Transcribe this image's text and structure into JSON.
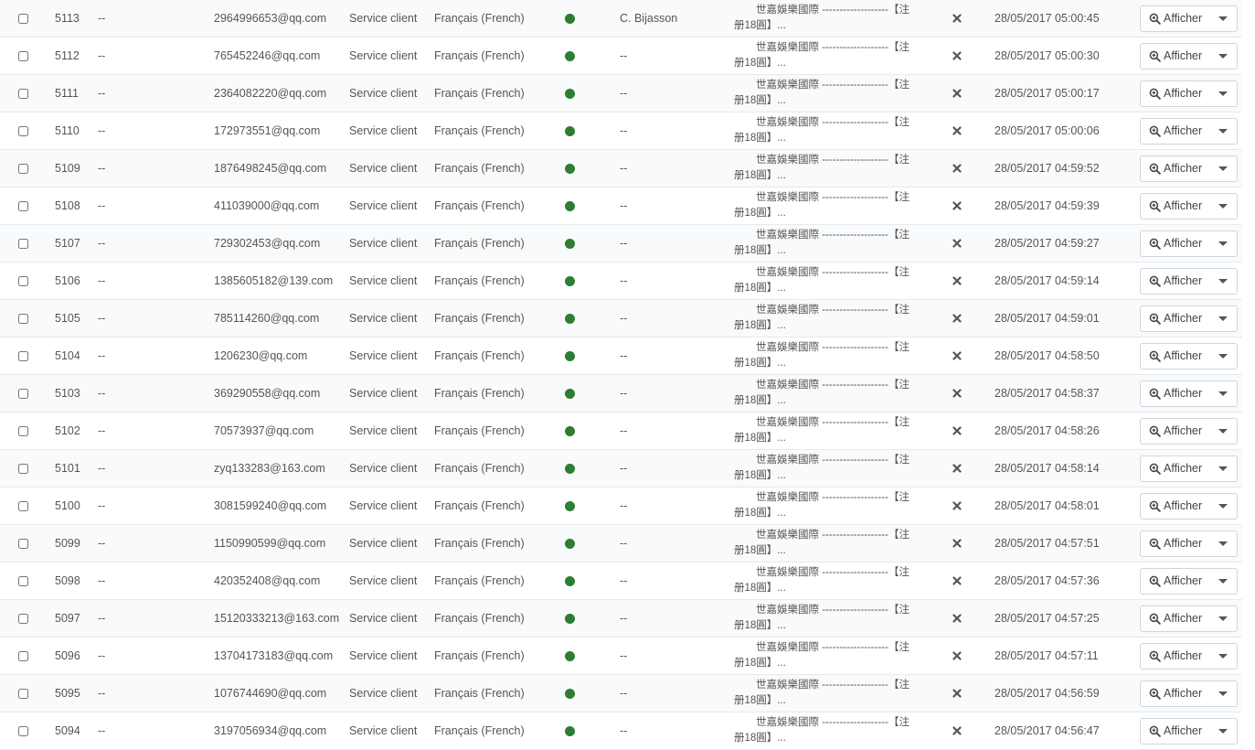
{
  "rows": [
    {
      "id": "5113",
      "col2": "--",
      "email": "2964996653@qq.com",
      "contact": "Service client",
      "language": "Français (French)",
      "employee": "C. Bijasson",
      "message_line1": "世嘉娛樂國際 -------------------【注",
      "message_line2": "册18圓】...",
      "date": "28/05/2017 05:00:45",
      "action_label": "Afficher"
    },
    {
      "id": "5112",
      "col2": "--",
      "email": "765452246@qq.com",
      "contact": "Service client",
      "language": "Français (French)",
      "employee": "--",
      "message_line1": "世嘉娛樂國際 -------------------【注",
      "message_line2": "册18圓】...",
      "date": "28/05/2017 05:00:30",
      "action_label": "Afficher"
    },
    {
      "id": "5111",
      "col2": "--",
      "email": "2364082220@qq.com",
      "contact": "Service client",
      "language": "Français (French)",
      "employee": "--",
      "message_line1": "世嘉娛樂國際 -------------------【注",
      "message_line2": "册18圓】...",
      "date": "28/05/2017 05:00:17",
      "action_label": "Afficher"
    },
    {
      "id": "5110",
      "col2": "--",
      "email": "172973551@qq.com",
      "contact": "Service client",
      "language": "Français (French)",
      "employee": "--",
      "message_line1": "世嘉娛樂國際 -------------------【注",
      "message_line2": "册18圓】...",
      "date": "28/05/2017 05:00:06",
      "action_label": "Afficher"
    },
    {
      "id": "5109",
      "col2": "--",
      "email": "1876498245@qq.com",
      "contact": "Service client",
      "language": "Français (French)",
      "employee": "--",
      "message_line1": "世嘉娛樂國際 -------------------【注",
      "message_line2": "册18圓】...",
      "date": "28/05/2017 04:59:52",
      "action_label": "Afficher"
    },
    {
      "id": "5108",
      "col2": "--",
      "email": "411039000@qq.com",
      "contact": "Service client",
      "language": "Français (French)",
      "employee": "--",
      "message_line1": "世嘉娛樂國際 -------------------【注",
      "message_line2": "册18圓】...",
      "date": "28/05/2017 04:59:39",
      "action_label": "Afficher"
    },
    {
      "id": "5107",
      "col2": "--",
      "email": "729302453@qq.com",
      "contact": "Service client",
      "language": "Français (French)",
      "employee": "--",
      "message_line1": "世嘉娛樂國際 -------------------【注",
      "message_line2": "册18圓】...",
      "date": "28/05/2017 04:59:27",
      "action_label": "Afficher"
    },
    {
      "id": "5106",
      "col2": "--",
      "email": "1385605182@139.com",
      "contact": "Service client",
      "language": "Français (French)",
      "employee": "--",
      "message_line1": "世嘉娛樂國際 -------------------【注",
      "message_line2": "册18圓】...",
      "date": "28/05/2017 04:59:14",
      "action_label": "Afficher"
    },
    {
      "id": "5105",
      "col2": "--",
      "email": "785114260@qq.com",
      "contact": "Service client",
      "language": "Français (French)",
      "employee": "--",
      "message_line1": "世嘉娛樂國際 -------------------【注",
      "message_line2": "册18圓】...",
      "date": "28/05/2017 04:59:01",
      "action_label": "Afficher"
    },
    {
      "id": "5104",
      "col2": "--",
      "email": "1206230@qq.com",
      "contact": "Service client",
      "language": "Français (French)",
      "employee": "--",
      "message_line1": "世嘉娛樂國際 -------------------【注",
      "message_line2": "册18圓】...",
      "date": "28/05/2017 04:58:50",
      "action_label": "Afficher"
    },
    {
      "id": "5103",
      "col2": "--",
      "email": "369290558@qq.com",
      "contact": "Service client",
      "language": "Français (French)",
      "employee": "--",
      "message_line1": "世嘉娛樂國際 -------------------【注",
      "message_line2": "册18圓】...",
      "date": "28/05/2017 04:58:37",
      "action_label": "Afficher"
    },
    {
      "id": "5102",
      "col2": "--",
      "email": "70573937@qq.com",
      "contact": "Service client",
      "language": "Français (French)",
      "employee": "--",
      "message_line1": "世嘉娛樂國際 -------------------【注",
      "message_line2": "册18圓】...",
      "date": "28/05/2017 04:58:26",
      "action_label": "Afficher"
    },
    {
      "id": "5101",
      "col2": "--",
      "email": "zyq133283@163.com",
      "contact": "Service client",
      "language": "Français (French)",
      "employee": "--",
      "message_line1": "世嘉娛樂國際 -------------------【注",
      "message_line2": "册18圓】...",
      "date": "28/05/2017 04:58:14",
      "action_label": "Afficher"
    },
    {
      "id": "5100",
      "col2": "--",
      "email": "3081599240@qq.com",
      "contact": "Service client",
      "language": "Français (French)",
      "employee": "--",
      "message_line1": "世嘉娛樂國際 -------------------【注",
      "message_line2": "册18圓】...",
      "date": "28/05/2017 04:58:01",
      "action_label": "Afficher"
    },
    {
      "id": "5099",
      "col2": "--",
      "email": "1150990599@qq.com",
      "contact": "Service client",
      "language": "Français (French)",
      "employee": "--",
      "message_line1": "世嘉娛樂國際 -------------------【注",
      "message_line2": "册18圓】...",
      "date": "28/05/2017 04:57:51",
      "action_label": "Afficher"
    },
    {
      "id": "5098",
      "col2": "--",
      "email": "420352408@qq.com",
      "contact": "Service client",
      "language": "Français (French)",
      "employee": "--",
      "message_line1": "世嘉娛樂國際 -------------------【注",
      "message_line2": "册18圓】...",
      "date": "28/05/2017 04:57:36",
      "action_label": "Afficher"
    },
    {
      "id": "5097",
      "col2": "--",
      "email": "15120333213@163.com",
      "contact": "Service client",
      "language": "Français (French)",
      "employee": "--",
      "message_line1": "世嘉娛樂國際 -------------------【注",
      "message_line2": "册18圓】...",
      "date": "28/05/2017 04:57:25",
      "action_label": "Afficher"
    },
    {
      "id": "5096",
      "col2": "--",
      "email": "13704173183@qq.com",
      "contact": "Service client",
      "language": "Français (French)",
      "employee": "--",
      "message_line1": "世嘉娛樂國際 -------------------【注",
      "message_line2": "册18圓】...",
      "date": "28/05/2017 04:57:11",
      "action_label": "Afficher"
    },
    {
      "id": "5095",
      "col2": "--",
      "email": "1076744690@qq.com",
      "contact": "Service client",
      "language": "Français (French)",
      "employee": "--",
      "message_line1": "世嘉娛樂國際 -------------------【注",
      "message_line2": "册18圓】...",
      "date": "28/05/2017 04:56:59",
      "action_label": "Afficher"
    },
    {
      "id": "5094",
      "col2": "--",
      "email": "3197056934@qq.com",
      "contact": "Service client",
      "language": "Français (French)",
      "employee": "--",
      "message_line1": "世嘉娛樂國際 -------------------【注",
      "message_line2": "册18圓】...",
      "date": "28/05/2017 04:56:47",
      "action_label": "Afficher"
    }
  ],
  "colors": {
    "status_online": "#2e7d32",
    "row_alt": "#f8fafc",
    "row_border": "#e6eaee"
  },
  "icons": {
    "status": "status-dot-icon",
    "unread": "close-icon",
    "view": "zoom-in-icon",
    "more": "chevron-down-icon"
  }
}
